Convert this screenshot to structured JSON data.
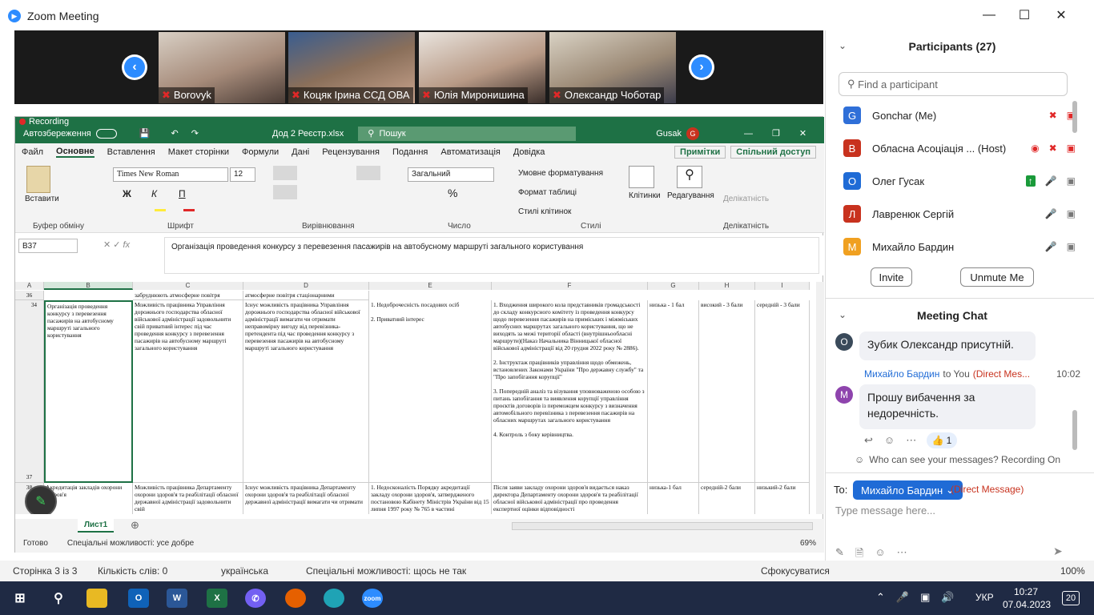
{
  "zoom": {
    "title": "Zoom Meeting",
    "recording": "Recording",
    "participants": [
      {
        "name": "Borovyk"
      },
      {
        "name": "Коцяк Ірина ССД ОВА"
      },
      {
        "name": "Юлія Миронишина"
      },
      {
        "name": "Олександр Чоботар"
      }
    ]
  },
  "excel": {
    "autosave": "Автозбереження",
    "filename": "Дод 2 Реєстр.xlsx",
    "search": "Пошук",
    "user": "Gusak",
    "menu": [
      "Файл",
      "Основне",
      "Вставлення",
      "Макет сторінки",
      "Формули",
      "Дані",
      "Рецензування",
      "Подання",
      "Автоматизація",
      "Довідка"
    ],
    "notes_btn": "Примітки",
    "share_btn": "Спільний доступ",
    "font_name": "Times New Roman",
    "font_size": "12",
    "number_format": "Загальний",
    "ribbon": {
      "paste": "Вставити",
      "clipboard": "Буфер обміну",
      "font": "Шрифт",
      "align": "Вирівнювання",
      "number": "Число",
      "styles": "Стилі",
      "cells": "Клітинки",
      "editing": "Редагування",
      "sensitivity": "Делікатність",
      "cond_format": "Умовне форматування",
      "table_format": "Формат таблиці",
      "cell_styles": "Стилі клітинок",
      "sens_btn": "Делікатність"
    },
    "namebox": "B37",
    "formula": "Організація проведення конкурсу з перевезення пасажирів на автобусному маршруті загального користування",
    "columns": [
      "A",
      "B",
      "C",
      "D",
      "E",
      "F",
      "G",
      "H",
      "I"
    ],
    "row36": {
      "num": "36",
      "c": "забруднюють атмосферне повітря",
      "d": "атмосферне повітря стаціонарними"
    },
    "row37": {
      "num": "37",
      "a": "34",
      "b": "Організація проведення конкурсу з перевезення пасажирів на автобусному маршруті загального користування",
      "c": "Можливість працівника Управління дорожнього господарства обласної військової адміністрації задовольнити свій приватний інтерес під час проведення конкурсу з перевезення пасажирів на автобусному маршруті загального користування",
      "d": "Існує можливість працівника Управління дорожнього господарства обласної військової адміністрації вимагати чи отримати неправомірну вигоду від перевізника-претендента під час проведення конкурсу з перевезення пасажирів на автобусному маршруті загального користування",
      "e": "1. Недоброчесність посадових осіб\n\n2. Приватний інтерес",
      "f": "1. Входження широкого кола представників громадськості до складу конкурсного комітету із проведення конкурсу щодо перевезення пасажирів на приміських і міжміських автобусних маршрутах загального користування, що не виходять за межі території області (внутрішньообласні маршрути)(Наказ Начальника Вінницької обласної військової адміністрації від 20 грудня 2022 року № 2886).\n\n2. Інструктаж працівників управління щодо обмежень, встановлених Законами України \"Про державну службу\" та \"Про запобігання корупції\"\n\n3. Попередній аналіз та візування уповноваженою особою з питань запобігання та виявлення корупції управління проєктів договорів із переможцем конкурсу з визначення автомобільного перевізника з перевезення пасажирів на обласних маршрутах загального користування\n\n4. Контроль з боку керівництва.",
      "g": "низька - 1 бал",
      "h": "високий - 3 бали",
      "i": "середній - 3 бали"
    },
    "row38": {
      "num": "38",
      "b": "Акредитація закладів охорони здоров'я",
      "c": "Можливість працівника Департаменту охорони здоров'я та реабілітації обласної державної адміністрації задовольнити свій",
      "d": "Існує можливість працівника Департаменту охорони здоров'я та реабілітації обласної державної адміністрації вимагати чи отримати",
      "e": "1. Недосконалість Порядку акредитації закладу охорони здоров'я, затвердженого постановою Кабінету Міністрів України від 15 липня 1997 року № 765 в частині",
      "f": "Після заяви закладу охорони здоров'я видається наказ директора Департаменту охорони здоров'я та реабілітації обласної військової адміністрації про проведення експертної оцінки відповідності",
      "g": "низька-1 бал",
      "h": "середній-2 бали",
      "i": "низький-2 бали"
    },
    "sheet": "Лист1",
    "status_ready": "Готово",
    "status_access": "Спеціальні можливості: усе добре",
    "zoom_level": "69%"
  },
  "panel": {
    "participants_title": "Participants (27)",
    "search_placeholder": "Find a participant",
    "people": [
      {
        "initial": "G",
        "name": "Gonchar (Me)",
        "color": "#2f6fd8"
      },
      {
        "initial": "В",
        "name": "Обласна Асоціація ... (Host)",
        "color": "#c8321e"
      },
      {
        "initial": "О",
        "name": "Олег Гусак",
        "color": "#1f6bd6"
      },
      {
        "initial": "Л",
        "name": "Лавренюк Сергій",
        "color": "#c8321e"
      },
      {
        "initial": "М",
        "name": "Михайло Бардин",
        "color": "#f0a020"
      }
    ],
    "invite": "Invite",
    "unmute": "Unmute Me",
    "chat_title": "Meeting Chat",
    "msg1": "Зубик Олександр присутній.",
    "msg2_sender": "Михайло Бардин",
    "msg2_to": "to You",
    "msg2_dm": "(Direct Mes...",
    "msg2_time": "10:02",
    "msg2": "Прошу вибачення за недоречність.",
    "reaction": "1",
    "who_can_see": "Who can see your messages? Recording On",
    "to_label": "To:",
    "to_value": "Михайло Бардин",
    "dm_label": "(Direct Message)",
    "input_placeholder": "Type message here..."
  },
  "word": {
    "page": "Сторінка 3 із 3",
    "words": "Кількість слів: 0",
    "lang": "українська",
    "access": "Спеціальні можливості: щось не так",
    "focus": "Сфокусуватися",
    "zoom": "100%"
  },
  "taskbar": {
    "lang": "УКР",
    "time": "10:27",
    "date": "07.04.2023",
    "notif": "20"
  }
}
